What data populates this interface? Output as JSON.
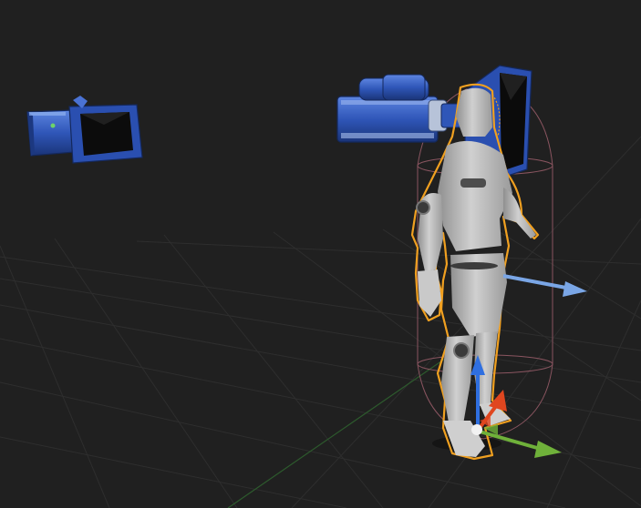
{
  "viewport": {
    "background": "#202020",
    "grid_color": "#2e2e2e",
    "grid_axis_green": "#2d5a2d",
    "selection_outline": "#f0a020",
    "capsule_color": "#8a5560",
    "camera_blue": "#2f56b8",
    "mannequin_grey": "#b8b8b8",
    "gizmo": {
      "x_axis_color": "#6fb13a",
      "y_axis_color": "#e0461f",
      "z_axis_color": "#2f6fe0",
      "forward_arrow_color": "#7aa6e6"
    },
    "objects": [
      {
        "name": "camera-actor",
        "icon": "camera-icon",
        "selected": false
      },
      {
        "name": "mannequin-character",
        "icon": "character-icon",
        "selected": true
      },
      {
        "name": "attached-camera",
        "icon": "camera-icon",
        "selected": false
      }
    ]
  }
}
